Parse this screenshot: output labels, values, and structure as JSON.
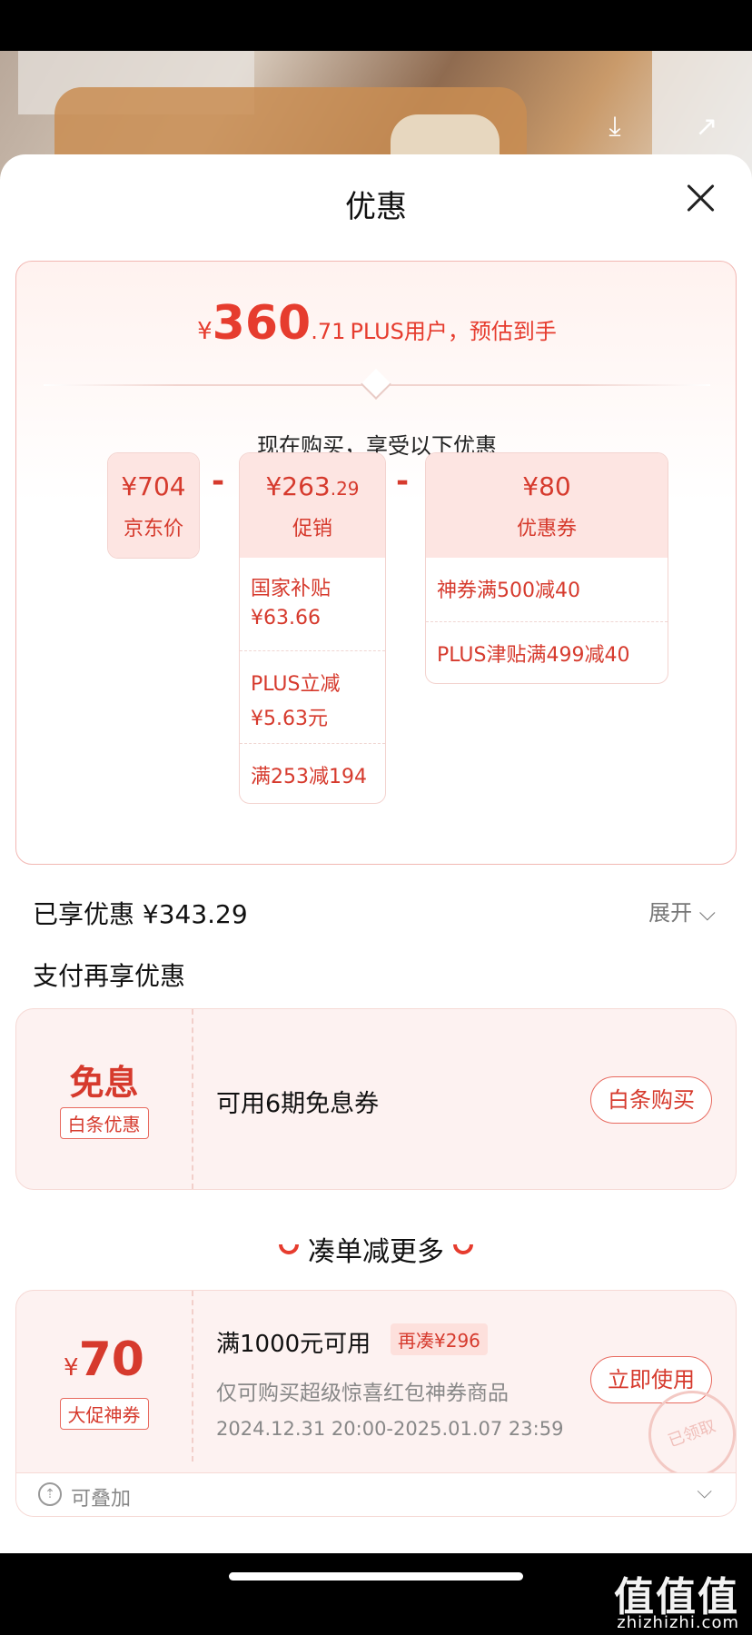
{
  "photo_actions": {
    "download_icon": "⤓",
    "share_icon": "↗"
  },
  "sheet": {
    "title": "优惠"
  },
  "summary": {
    "currency": "¥",
    "estimated_int": "360",
    "estimated_dec": ".71",
    "estimated_text": "PLUS用户，预估到手",
    "subhead": "现在购买，享受以下优惠",
    "jd_price": {
      "amount": "¥704",
      "label": "京东价"
    },
    "minus": "-",
    "promotion": {
      "amount_main": "¥263",
      "amount_dec": ".29",
      "label": "促销",
      "items": [
        {
          "line1": "国家补贴",
          "line2": "¥63.66"
        },
        {
          "line1": "PLUS立减",
          "line2": "¥5.63元"
        },
        {
          "line1": "满253减194",
          "line2": ""
        }
      ]
    },
    "coupon": {
      "amount": "¥80",
      "label": "优惠券",
      "items": [
        "神券满500减40",
        "PLUS津贴满499减40"
      ]
    }
  },
  "enjoyed": {
    "label": "已享优惠 ¥343.29",
    "expand": "展开 ⌵"
  },
  "pay_more": {
    "title": "支付再享优惠"
  },
  "interest_free": {
    "title": "免息",
    "badge": "白条优惠",
    "desc": "可用6期免息券",
    "button": "白条购买"
  },
  "more_section": {
    "title": "凑单减更多"
  },
  "coupon_card": {
    "currency": "¥",
    "amount": "70",
    "badge": "大促神券",
    "title": "满1000元可用",
    "tag": "再凑¥296",
    "desc": "仅可购买超级惊喜红包神券商品",
    "time": "2024.12.31 20:00-2025.01.07 23:59",
    "button": "立即使用",
    "stamp": "已领取",
    "stackable": "可叠加",
    "chevron": "⌵"
  },
  "watermark": {
    "main": "值值值",
    "sub": "zhizhizhi.com"
  },
  "colors": {
    "accent": "#e63c2e",
    "card_bg": "#fdf2f1",
    "head_bg": "#fde5e2"
  }
}
